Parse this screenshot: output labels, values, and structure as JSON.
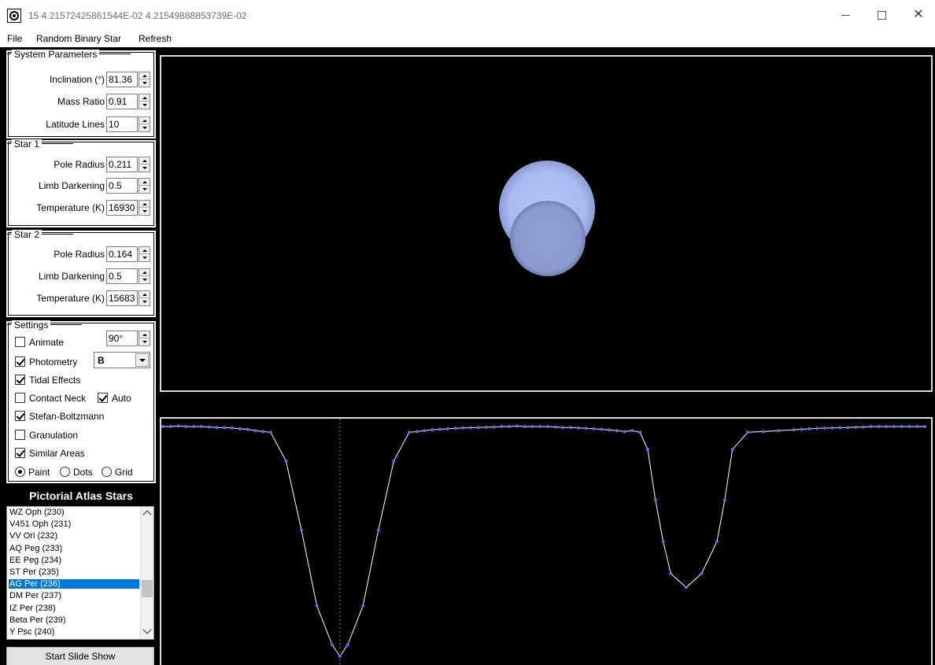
{
  "window": {
    "title": "15 4.21572425861544E-02 4.21549888853739E-02",
    "minimize_glyph": "—",
    "close_glyph": "✕"
  },
  "menu": {
    "file": "File",
    "random": "Random Binary Star",
    "refresh": "Refresh"
  },
  "system": {
    "title": "System Parameters",
    "inclination_label": "Inclination (°)",
    "inclination": "81.36",
    "mass_ratio_label": "Mass Ratio",
    "mass_ratio": "0.91",
    "latitude_label": "Latitude Lines",
    "latitude": "10"
  },
  "star1": {
    "title": "Star 1",
    "pole_radius_label": "Pole Radius",
    "pole_radius": "0.211",
    "limb_label": "Limb Darkening",
    "limb": "0.5",
    "temp_label": "Temperature (K)",
    "temp": "16930"
  },
  "star2": {
    "title": "Star 2",
    "pole_radius_label": "Pole Radius",
    "pole_radius": "0.164",
    "limb_label": "Limb Darkening",
    "limb": "0.5",
    "temp_label": "Temperature (K)",
    "temp": "15683"
  },
  "settings": {
    "title": "Settings",
    "animate_label": "Animate",
    "animate_checked": false,
    "angle": "90°",
    "photometry_label": "Photometry",
    "photometry_checked": true,
    "filter": "B",
    "tidal_label": "Tidal Effects",
    "tidal_checked": true,
    "contact_label": "Contact Neck",
    "contact_checked": false,
    "auto_label": "Auto",
    "auto_checked": true,
    "stefan_label": "Stefan-Boltzmann",
    "stefan_checked": true,
    "granulation_label": "Granulation",
    "granulation_checked": false,
    "similar_label": "Similar Areas",
    "similar_checked": true,
    "paint_label": "Paint",
    "dots_label": "Dots",
    "grid_label": "Grid",
    "render_mode": "Paint"
  },
  "atlas": {
    "title": "Pictorial Atlas Stars",
    "items": [
      "WZ Oph (230)",
      "V451 Oph (231)",
      "VV Ori (232)",
      "AQ Peg (233)",
      "EE Peg (234)",
      "ST Per (235)",
      "AG Per (236)",
      "DM Per (237)",
      "IZ Per (238)",
      "Beta Per (239)",
      "Y Psc (240)"
    ],
    "selected": "AG Per (236)",
    "slideshow_label": "Start Slide Show"
  },
  "colors": {
    "star_primary": "#a9b9ee",
    "star_secondary": "#8c9bcc",
    "curve_line": "#ffffff",
    "curve_points": "#5a6cf0",
    "selection": "#0078d7"
  },
  "chart_data": {
    "type": "line",
    "title": "",
    "xlabel": "",
    "ylabel": "",
    "phase_marker": 0.0,
    "x": [
      -0.23,
      -0.22,
      -0.21,
      -0.2,
      -0.19,
      -0.18,
      -0.17,
      -0.16,
      -0.15,
      -0.14,
      -0.13,
      -0.12,
      -0.11,
      -0.1,
      -0.09,
      -0.07,
      -0.05,
      -0.03,
      -0.01,
      0.0,
      0.01,
      0.03,
      0.05,
      0.07,
      0.09,
      0.1,
      0.11,
      0.12,
      0.13,
      0.14,
      0.15,
      0.16,
      0.17,
      0.18,
      0.19,
      0.2,
      0.21,
      0.22,
      0.23,
      0.24,
      0.25,
      0.26,
      0.27,
      0.28,
      0.29,
      0.3,
      0.31,
      0.32,
      0.33,
      0.34,
      0.35,
      0.36,
      0.37,
      0.38,
      0.39,
      0.4,
      0.41,
      0.42,
      0.43,
      0.45,
      0.47,
      0.49,
      0.5,
      0.51,
      0.53,
      0.55,
      0.57,
      0.59,
      0.6,
      0.61,
      0.62,
      0.63,
      0.64,
      0.65,
      0.66,
      0.67,
      0.68,
      0.69,
      0.7,
      0.71,
      0.72,
      0.73,
      0.74,
      0.75,
      0.76
    ],
    "values": [
      1.0,
      1.0,
      1.002,
      1.0,
      1.0,
      1.0,
      0.998,
      0.996,
      0.995,
      0.994,
      0.99,
      0.988,
      0.982,
      0.978,
      0.975,
      0.85,
      0.55,
      0.22,
      0.05,
      0.0,
      0.05,
      0.22,
      0.55,
      0.85,
      0.975,
      0.978,
      0.982,
      0.986,
      0.988,
      0.99,
      0.992,
      0.994,
      0.995,
      0.996,
      0.997,
      0.998,
      1.0,
      1.0,
      1.002,
      1.0,
      1.0,
      1.0,
      1.0,
      0.998,
      0.996,
      0.996,
      0.994,
      0.992,
      0.99,
      0.988,
      0.985,
      0.982,
      0.978,
      0.982,
      0.975,
      0.9,
      0.68,
      0.5,
      0.36,
      0.3,
      0.36,
      0.5,
      0.68,
      0.9,
      0.975,
      0.978,
      0.982,
      0.986,
      0.988,
      0.99,
      0.992,
      0.993,
      0.994,
      0.995,
      0.996,
      0.997,
      0.998,
      1.0,
      1.0,
      1.0,
      1.0,
      1.0,
      1.0,
      1.0,
      1.0
    ],
    "xlim": [
      -0.23,
      0.76
    ],
    "ylim": [
      0.0,
      1.0
    ]
  }
}
